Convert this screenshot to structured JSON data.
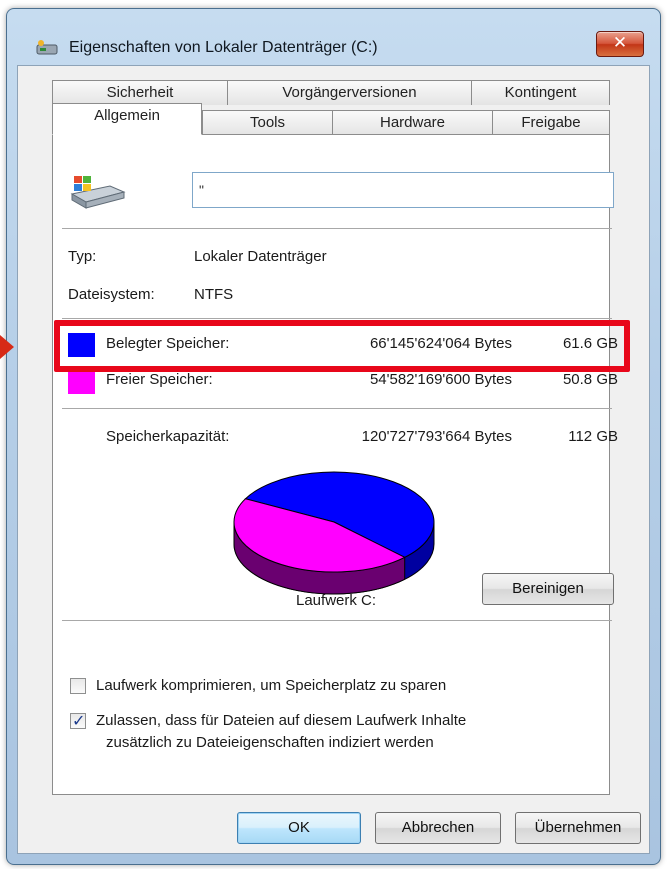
{
  "window": {
    "title": "Eigenschaften von Lokaler Datenträger (C:)",
    "close_label": "✕"
  },
  "tabs": {
    "row1": [
      "Sicherheit",
      "Vorgängerversionen",
      "Kontingent"
    ],
    "row2": [
      "Allgemein",
      "Tools",
      "Hardware",
      "Freigabe"
    ],
    "active": "Allgemein"
  },
  "general": {
    "name_value": "\"",
    "type_label": "Typ:",
    "type_value": "Lokaler Datenträger",
    "fs_label": "Dateisystem:",
    "fs_value": "NTFS",
    "used_label": "Belegter Speicher:",
    "used_bytes": "66'145'624'064 Bytes",
    "used_gb": "61.6 GB",
    "free_label": "Freier Speicher:",
    "free_bytes": "54'582'169'600 Bytes",
    "free_gb": "50.8 GB",
    "capacity_label": "Speicherkapazität:",
    "capacity_bytes": "120'727'793'664 Bytes",
    "capacity_gb": "112 GB",
    "drive_label": "Laufwerk C:",
    "cleanup_label": "Bereinigen",
    "used_fraction": 0.548,
    "used_color": "#0000ff",
    "free_color": "#ff00ff"
  },
  "options": {
    "compress_label": "Laufwerk komprimieren, um Speicherplatz zu sparen",
    "compress_checked": false,
    "index_label_line1": "Zulassen, dass für Dateien auf diesem Laufwerk Inhalte",
    "index_label_line2": "zusätzlich zu Dateieigenschaften indiziert werden",
    "index_checked": true
  },
  "buttons": {
    "ok": "OK",
    "cancel": "Abbrechen",
    "apply": "Übernehmen"
  },
  "annotation": {
    "highlight_color": "#e8071a"
  }
}
